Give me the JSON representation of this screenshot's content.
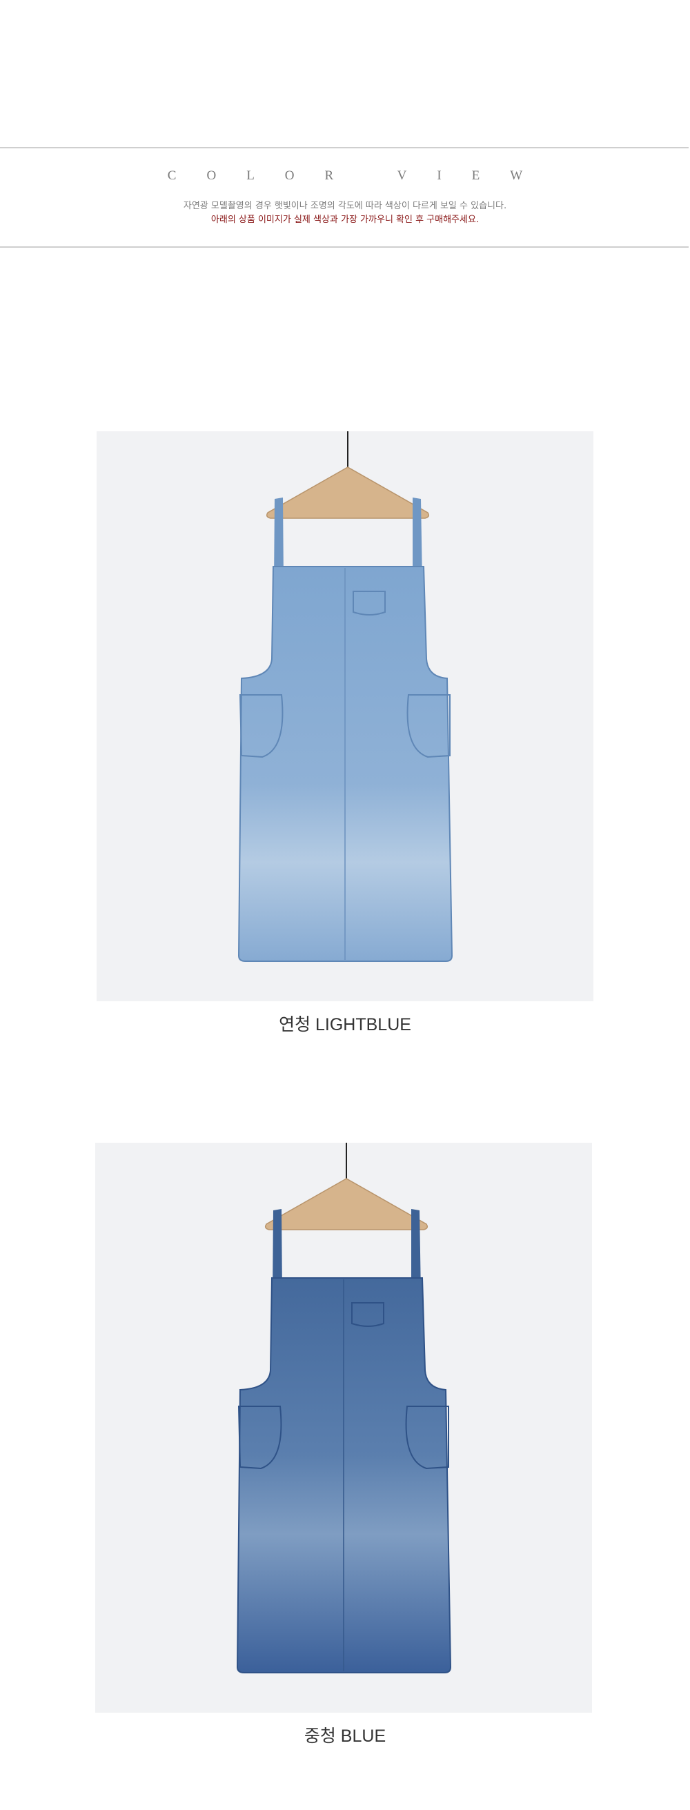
{
  "header": {
    "title": "COLOR VIEW",
    "notice_line_1": "자연광 모델촬영의 경우 햇빛이나 조명의 각도에 따라 색상이 다르게 보일 수 있습니다.",
    "notice_line_2": "아래의 상품 이미지가 실제 색상과 가장 가까우니 확인 후 구매해주세요."
  },
  "colors": [
    {
      "caption": "연청 LIGHTBLUE",
      "tone": "#7fa6d0",
      "tone_dark": "#5f87b6",
      "tone_light": "#b4cbe3"
    },
    {
      "caption": "중청 BLUE",
      "tone": "#44699c",
      "tone_dark": "#2f5287",
      "tone_light": "#7f9dc2"
    }
  ],
  "palette": {
    "rule": "#cfcfcf",
    "title_gray": "#7a7a7a",
    "notice_red": "#8b1a1a",
    "photo_bg": "#f1f2f4",
    "hanger_wood": "#d6b48c"
  }
}
